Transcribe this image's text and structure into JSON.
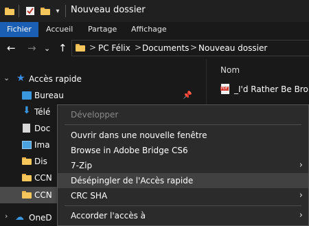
{
  "window": {
    "title": "Nouveau dossier"
  },
  "ribbon": {
    "tabs": [
      "Fichier",
      "Accueil",
      "Partage",
      "Affichage"
    ]
  },
  "address": {
    "crumbs": [
      "PC Félix",
      "Documents",
      "Nouveau dossier"
    ],
    "separator": ">"
  },
  "sidebar": {
    "quick_access_label": "Accès rapide",
    "items": [
      "Bureau",
      "Télé",
      "Doc",
      "Ima",
      "Dis",
      "CCN",
      "CCN"
    ],
    "bottom_item": "OneD"
  },
  "content": {
    "column_header": "Nom",
    "file_name": "_I'd Rather Be Broke",
    "file_badge": "PDF"
  },
  "context_menu": {
    "items": [
      {
        "label": "Développer",
        "disabled": true
      },
      {
        "label": "Ouvrir dans une nouvelle fenêtre"
      },
      {
        "label": "Browse in Adobe Bridge CS6"
      },
      {
        "label": "7-Zip",
        "submenu": true
      },
      {
        "label": "Désépingler de l'Accès rapide",
        "highlighted": true
      },
      {
        "label": "CRC SHA",
        "submenu": true
      },
      {
        "label": "Accorder l'accès à",
        "submenu": true
      }
    ],
    "arrow": "›"
  },
  "icons": {
    "quick_access": "star-icon",
    "desktop": "desktop-icon",
    "downloads": "download-icon",
    "documents": "documents-icon",
    "pictures": "pictures-icon",
    "folder": "folder-icon",
    "onedrive": "cloud-icon",
    "pin": "pin-icon",
    "pdf": "pdf-icon"
  },
  "colors": {
    "accent": "#1a5fb4",
    "background": "#191919",
    "menu_background": "#2b2b2b",
    "menu_highlight": "#414141",
    "folder": "#f5c65b"
  }
}
